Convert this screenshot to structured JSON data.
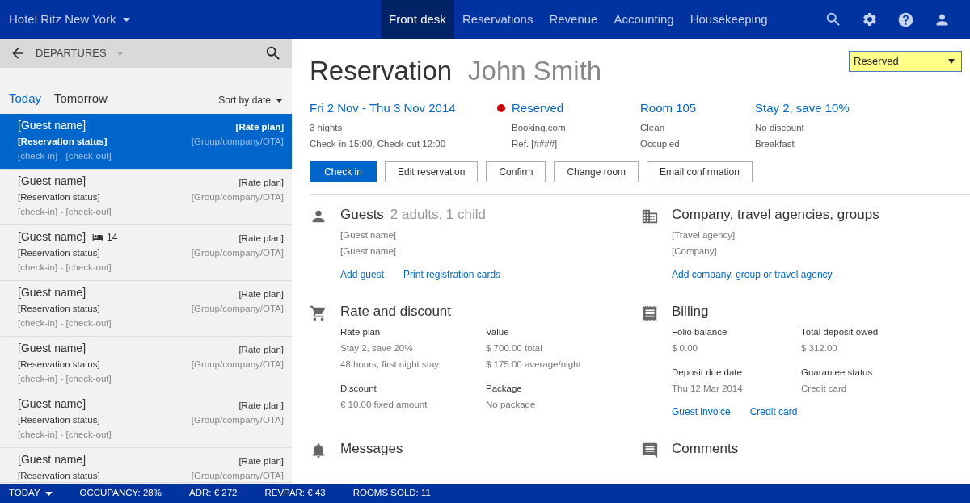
{
  "nav": {
    "hotel": "Hotel Ritz New York",
    "tabs": [
      {
        "label": "Front desk",
        "selected": true
      },
      {
        "label": "Reservations",
        "selected": false
      },
      {
        "label": "Revenue",
        "selected": false
      },
      {
        "label": "Accounting",
        "selected": false
      },
      {
        "label": "Housekeeping",
        "selected": false
      }
    ]
  },
  "list_panel": {
    "title": "DEPARTURES",
    "day_tabs": [
      {
        "label": "Today",
        "selected": true
      },
      {
        "label": "Tomorrow",
        "selected": false
      }
    ],
    "sort": "Sort by date",
    "items": [
      {
        "guest_name": "[Guest name]",
        "status": "[Reservation status]",
        "dates": "[check-in] - [check-out]",
        "rate_plan": "[Rate plan]",
        "group": "[Group/company/OTA]",
        "selected": true
      },
      {
        "guest_name": "[Guest name]",
        "status": "[Reservation status]",
        "dates": "[check-in] - [check-out]",
        "rate_plan": "[Rate plan]",
        "group": "[Group/company/OTA]",
        "selected": false
      },
      {
        "guest_name": "[Guest name]",
        "room": "14",
        "status": "[Reservation status]",
        "dates": "[check-in] - [check-out]",
        "rate_plan": "[Rate plan]",
        "group": "[Group/company/OTA]",
        "selected": false
      },
      {
        "guest_name": "[Guest name]",
        "status": "[Reservation status]",
        "dates": "[check-in] - [check-out]",
        "rate_plan": "[Rate plan]",
        "group": "[Group/company/OTA]",
        "selected": false
      },
      {
        "guest_name": "[Guest name]",
        "status": "[Reservation status]",
        "dates": "[check-in] - [check-out]",
        "rate_plan": "[Rate plan]",
        "group": "[Group/company/OTA]",
        "selected": false
      },
      {
        "guest_name": "[Guest name]",
        "status": "[Reservation status]",
        "dates": "[check-in] - [check-out]",
        "rate_plan": "[Rate plan]",
        "group": "[Group/company/OTA]",
        "selected": false
      },
      {
        "guest_name": "[Guest name]",
        "status": "[Reservation status]",
        "rate_plan": "[Rate plan]",
        "group": "[Group/company/OTA]",
        "selected": false
      }
    ]
  },
  "reservation": {
    "title": "Reservation",
    "guest": "John Smith",
    "status_select": "Reserved",
    "summary": [
      {
        "heading": "Fri 2 Nov - Thu 3 Nov 2014",
        "lines": [
          "3 nights",
          "Check-in 15:00, Check-out 12:00"
        ]
      },
      {
        "heading": "Reserved",
        "color": "#cc0000",
        "lines": [
          "Booking.com",
          "Ref. [####]"
        ]
      },
      {
        "heading": "Room 105",
        "lines": [
          "Clean",
          "Occupied"
        ]
      },
      {
        "heading": "Stay 2, save 10%",
        "lines": [
          "No discount",
          "Breakfast"
        ]
      }
    ],
    "buttons": [
      {
        "label": "Check in",
        "primary": true
      },
      {
        "label": "Edit reservation",
        "primary": false
      },
      {
        "label": "Confirm",
        "primary": false
      },
      {
        "label": "Change room",
        "primary": false
      },
      {
        "label": "Email confirmation",
        "primary": false
      }
    ],
    "sections": [
      {
        "kind": "guests",
        "title": "Guests",
        "subtitle": "2 adults, 1 child",
        "lines": [
          "[Guest name]",
          "[Guest name]"
        ],
        "links": [
          "Add guest",
          "Print registration cards"
        ]
      },
      {
        "kind": "company",
        "title": "Company, travel agencies, groups",
        "lines": [
          "[Travel agency]",
          "[Company]"
        ],
        "links": [
          "Add company, group or travel agency"
        ]
      },
      {
        "kind": "rate",
        "title": "Rate and discount",
        "fields": [
          {
            "label": "Rate plan",
            "values": [
              "Stay 2, save 20%",
              "48 hours, first night stay"
            ]
          },
          {
            "label": "Value",
            "values": [
              "$ 700.00 total",
              "$ 175.00 average/night"
            ]
          },
          {
            "label": "Discount",
            "values": [
              "€ 10.00 fixed amount"
            ]
          },
          {
            "label": "Package",
            "values": [
              "No package"
            ]
          }
        ]
      },
      {
        "kind": "billing",
        "title": "Billing",
        "fields": [
          {
            "label": "Folio balance",
            "values": [
              "$ 0.00"
            ]
          },
          {
            "label": "Total deposit owed",
            "values": [
              "$ 312.00"
            ]
          },
          {
            "label": "Deposit due date",
            "values": [
              "Thu 12 Mar 2014"
            ]
          },
          {
            "label": "Guarantee status",
            "values": [
              "Credit card"
            ]
          }
        ],
        "links": [
          "Guest invoice",
          "Credit card"
        ]
      },
      {
        "kind": "messages",
        "title": "Messages"
      },
      {
        "kind": "comments",
        "title": "Comments"
      }
    ]
  },
  "status_bar": {
    "period": "TODAY",
    "stats": [
      "OCCUPANCY: 28%",
      "ADR: € 272",
      "REVPAR: € 43",
      "ROOMS SOLD: 11"
    ]
  }
}
